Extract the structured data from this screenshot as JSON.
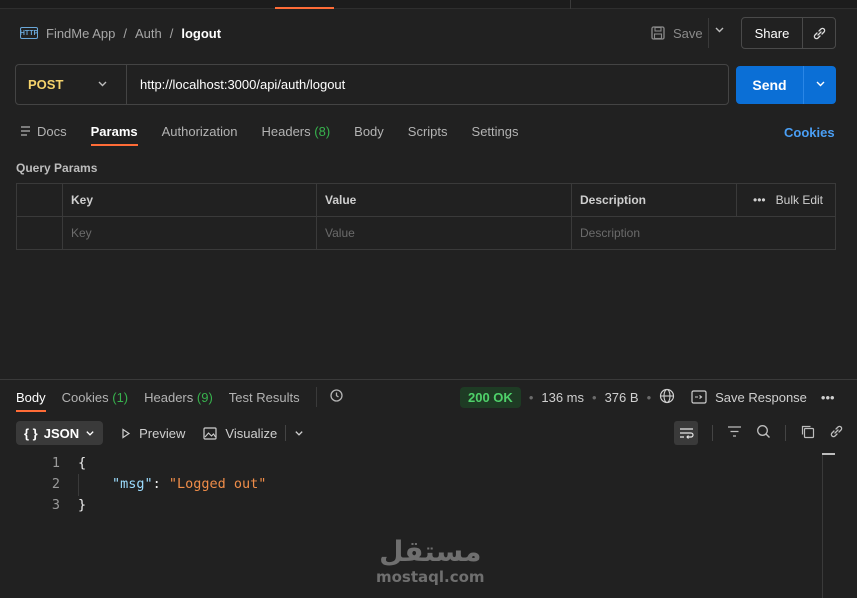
{
  "breadcrumb": {
    "collection": "FindMe App",
    "folder": "Auth",
    "request": "logout",
    "method_icon": "HTTP"
  },
  "header": {
    "save_label": "Save",
    "share_label": "Share"
  },
  "request": {
    "method": "POST",
    "url": "http://localhost:3000/api/auth/logout",
    "send_label": "Send"
  },
  "request_tabs": [
    {
      "label": "Docs"
    },
    {
      "label": "Params"
    },
    {
      "label": "Authorization"
    },
    {
      "label": "Headers",
      "count": "(8)"
    },
    {
      "label": "Body"
    },
    {
      "label": "Scripts"
    },
    {
      "label": "Settings"
    }
  ],
  "cookies_link": "Cookies",
  "query_params": {
    "title": "Query Params",
    "columns": [
      "Key",
      "Value",
      "Description"
    ],
    "bulk_edit": "Bulk Edit",
    "placeholders": {
      "key": "Key",
      "value": "Value",
      "description": "Description"
    }
  },
  "response_tabs": [
    {
      "label": "Body"
    },
    {
      "label": "Cookies",
      "count": "(1)"
    },
    {
      "label": "Headers",
      "count": "(9)"
    },
    {
      "label": "Test Results"
    }
  ],
  "response_status": {
    "code": "200 OK",
    "time": "136 ms",
    "size": "376 B",
    "save_label": "Save Response"
  },
  "format_bar": {
    "format": "JSON",
    "preview": "Preview",
    "visualize": "Visualize"
  },
  "response_body": {
    "line_numbers": [
      "1",
      "2",
      "3"
    ],
    "open_brace": "{",
    "key": "\"msg\"",
    "colon": ": ",
    "value": "\"Logged out\"",
    "close_brace": "}"
  },
  "watermark": {
    "arabic": "مستقل",
    "latin": "mostaql.com"
  },
  "colors": {
    "accent": "#ff6c37",
    "send": "#0b6fd6",
    "method": "#f5d36b",
    "ok": "#4fd16a"
  }
}
